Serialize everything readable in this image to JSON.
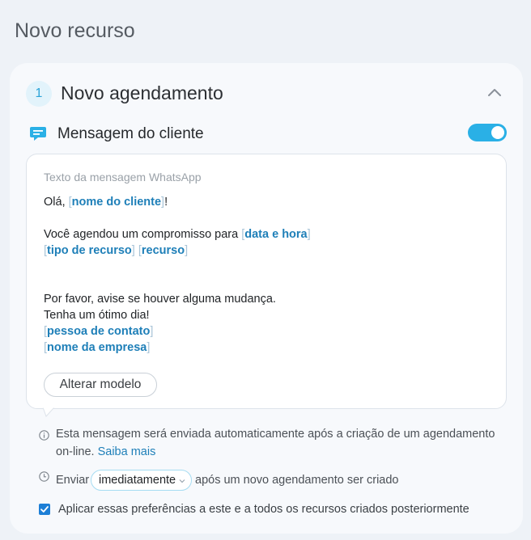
{
  "page": {
    "title": "Novo recurso"
  },
  "step": {
    "number": "1",
    "title": "Novo agendamento"
  },
  "message": {
    "label": "Mensagem do cliente",
    "enabled": true,
    "box_caption": "Texto da mensagem WhatsApp",
    "greeting": "Olá, ",
    "greeting_end": "!",
    "tok_nome_cliente": "nome do cliente",
    "line2": "Você agendou um compromisso para ",
    "tok_data_hora": "data e hora",
    "tok_tipo_recurso": "tipo de recurso",
    "tok_recurso": "recurso",
    "line4": "Por favor, avise se houver alguma mudança.",
    "line5": "Tenha um ótimo dia!",
    "tok_pessoa_contato": "pessoa de contato",
    "tok_nome_empresa": "nome da empresa",
    "change_template_button": "Alterar modelo"
  },
  "info": {
    "text": "Esta mensagem será enviada automaticamente após a criação de um agendamento on-line. ",
    "link": "Saiba mais"
  },
  "send": {
    "prefix": "Enviar",
    "selected_option": "imediatamente",
    "suffix": "após um novo agendamento ser criado"
  },
  "apply": {
    "checked": true,
    "label": "Aplicar essas preferências a este e a todos os recursos criados posteriormente"
  },
  "colors": {
    "accent": "#2ab0e6",
    "link": "#1e7fb8",
    "checkbox": "#1d7fd6"
  },
  "icons": [
    "chevron-up-icon",
    "chat-bubble-icon",
    "info-icon",
    "clock-icon",
    "chevron-down-icon",
    "check-icon"
  ]
}
